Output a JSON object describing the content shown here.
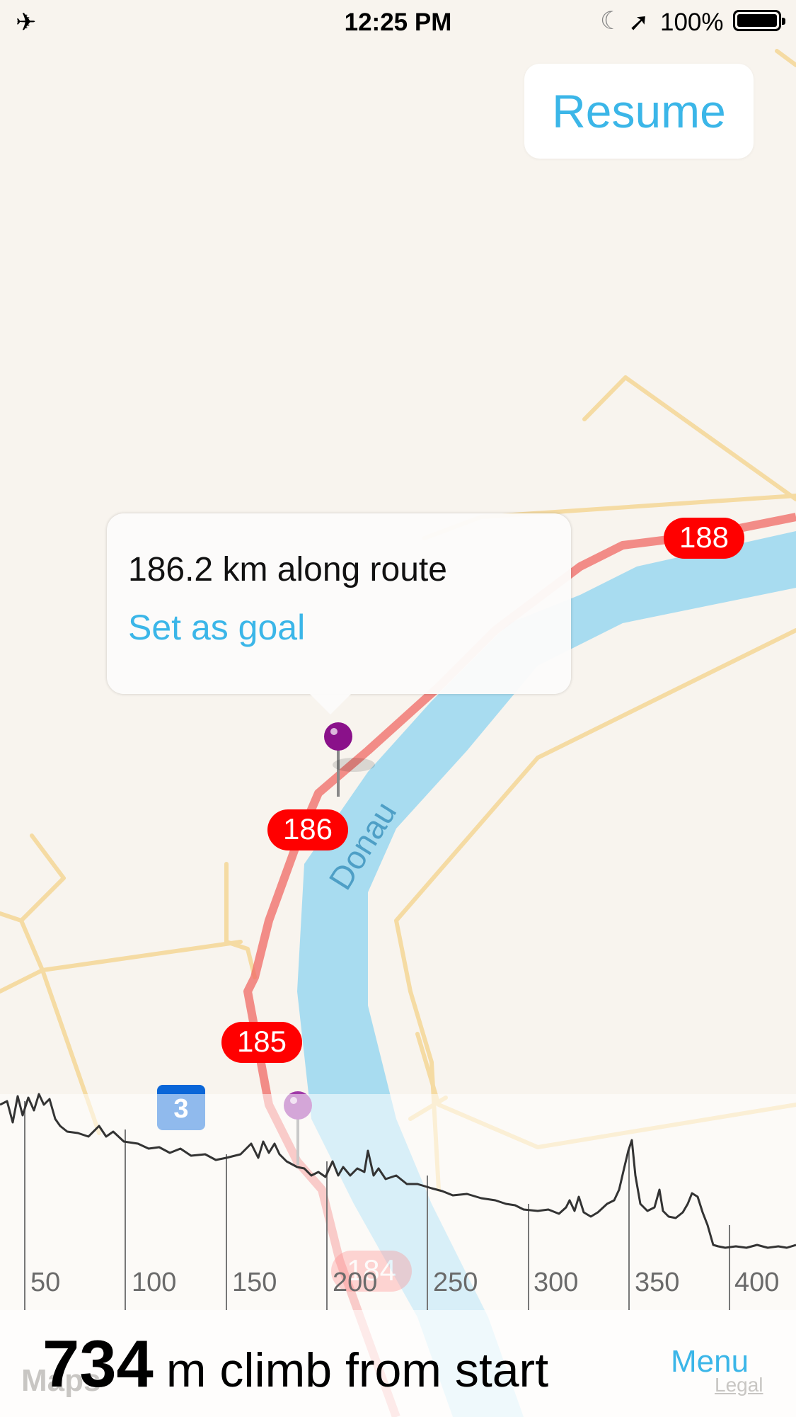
{
  "status_bar": {
    "time": "12:25 PM",
    "battery_percent": "100%",
    "airplane_mode": true,
    "battery_level": 1.0
  },
  "resume_button": {
    "label": "Resume"
  },
  "callout": {
    "title": "186.2 km along route",
    "action": "Set as goal"
  },
  "map": {
    "river_label": "Donau",
    "km_markers": [
      "188",
      "186",
      "185",
      "184"
    ],
    "route_badge": "3"
  },
  "elevation": {
    "ticks": [
      "50",
      "100",
      "150",
      "200",
      "250",
      "300",
      "350",
      "400"
    ]
  },
  "bottom": {
    "climb_value": "734",
    "climb_label": "m climb from start",
    "menu_label": "Menu",
    "maps_attribution": "Maps",
    "legal_label": "Legal"
  },
  "colors": {
    "accent": "#3bb6e8",
    "route": "#f06a64",
    "marker_badge": "#ff0000",
    "river": "#a8dcf0",
    "pin": "#8a118a",
    "route_badge_blue": "#0a66d8"
  }
}
